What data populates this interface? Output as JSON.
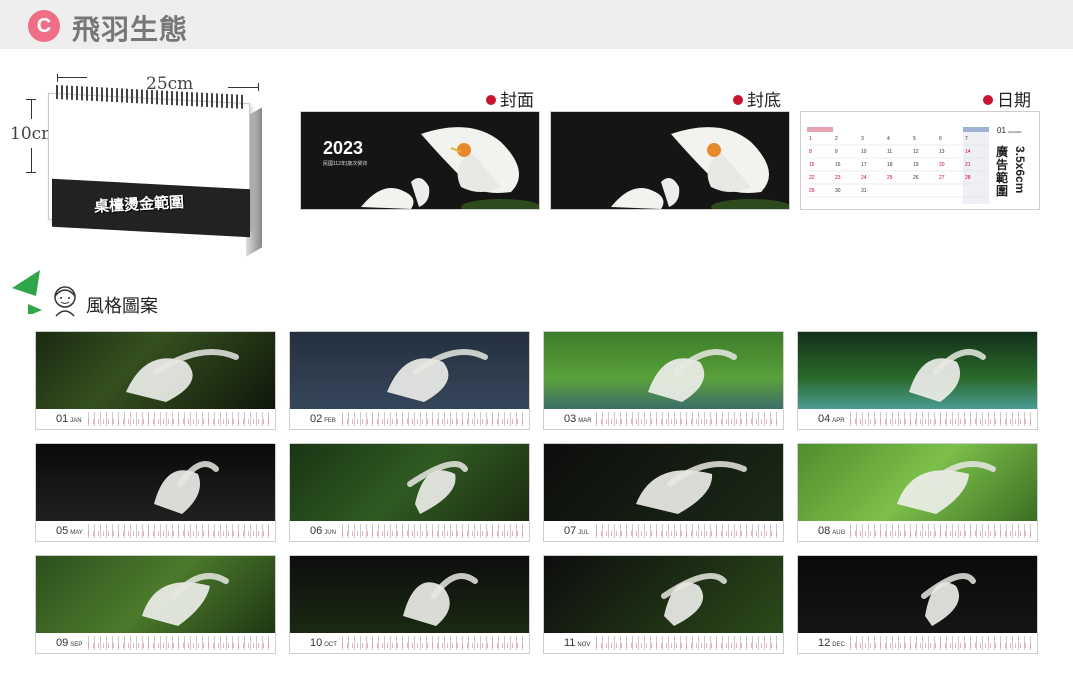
{
  "header": {
    "badge": "C",
    "title": "飛羽生態"
  },
  "product": {
    "width_label": "25cm",
    "height_label": "10cm",
    "stamp_label": "桌檯燙金範圍"
  },
  "panels": {
    "front": {
      "label": "封面",
      "year": "2023",
      "subtitle": "民國112年|歲次癸卯"
    },
    "back": {
      "label": "封底"
    },
    "date": {
      "label": "日期",
      "month": "01",
      "month_name": "JANUARY",
      "ad_text": "廣告範圍",
      "ad_size": "3.5x6cm"
    }
  },
  "style": {
    "title": "風格圖案"
  },
  "months": [
    {
      "num": "01",
      "name": "JAN"
    },
    {
      "num": "02",
      "name": "FEB"
    },
    {
      "num": "03",
      "name": "MAR"
    },
    {
      "num": "04",
      "name": "APR"
    },
    {
      "num": "05",
      "name": "MAY"
    },
    {
      "num": "06",
      "name": "JUN"
    },
    {
      "num": "07",
      "name": "JUL"
    },
    {
      "num": "08",
      "name": "AUG"
    },
    {
      "num": "09",
      "name": "SEP"
    },
    {
      "num": "10",
      "name": "OCT"
    },
    {
      "num": "11",
      "name": "NOV"
    },
    {
      "num": "12",
      "name": "DEC"
    }
  ],
  "colors": {
    "badge": "#ee6f86",
    "dot": "#c8142c",
    "accent_red": "#cc1133"
  }
}
